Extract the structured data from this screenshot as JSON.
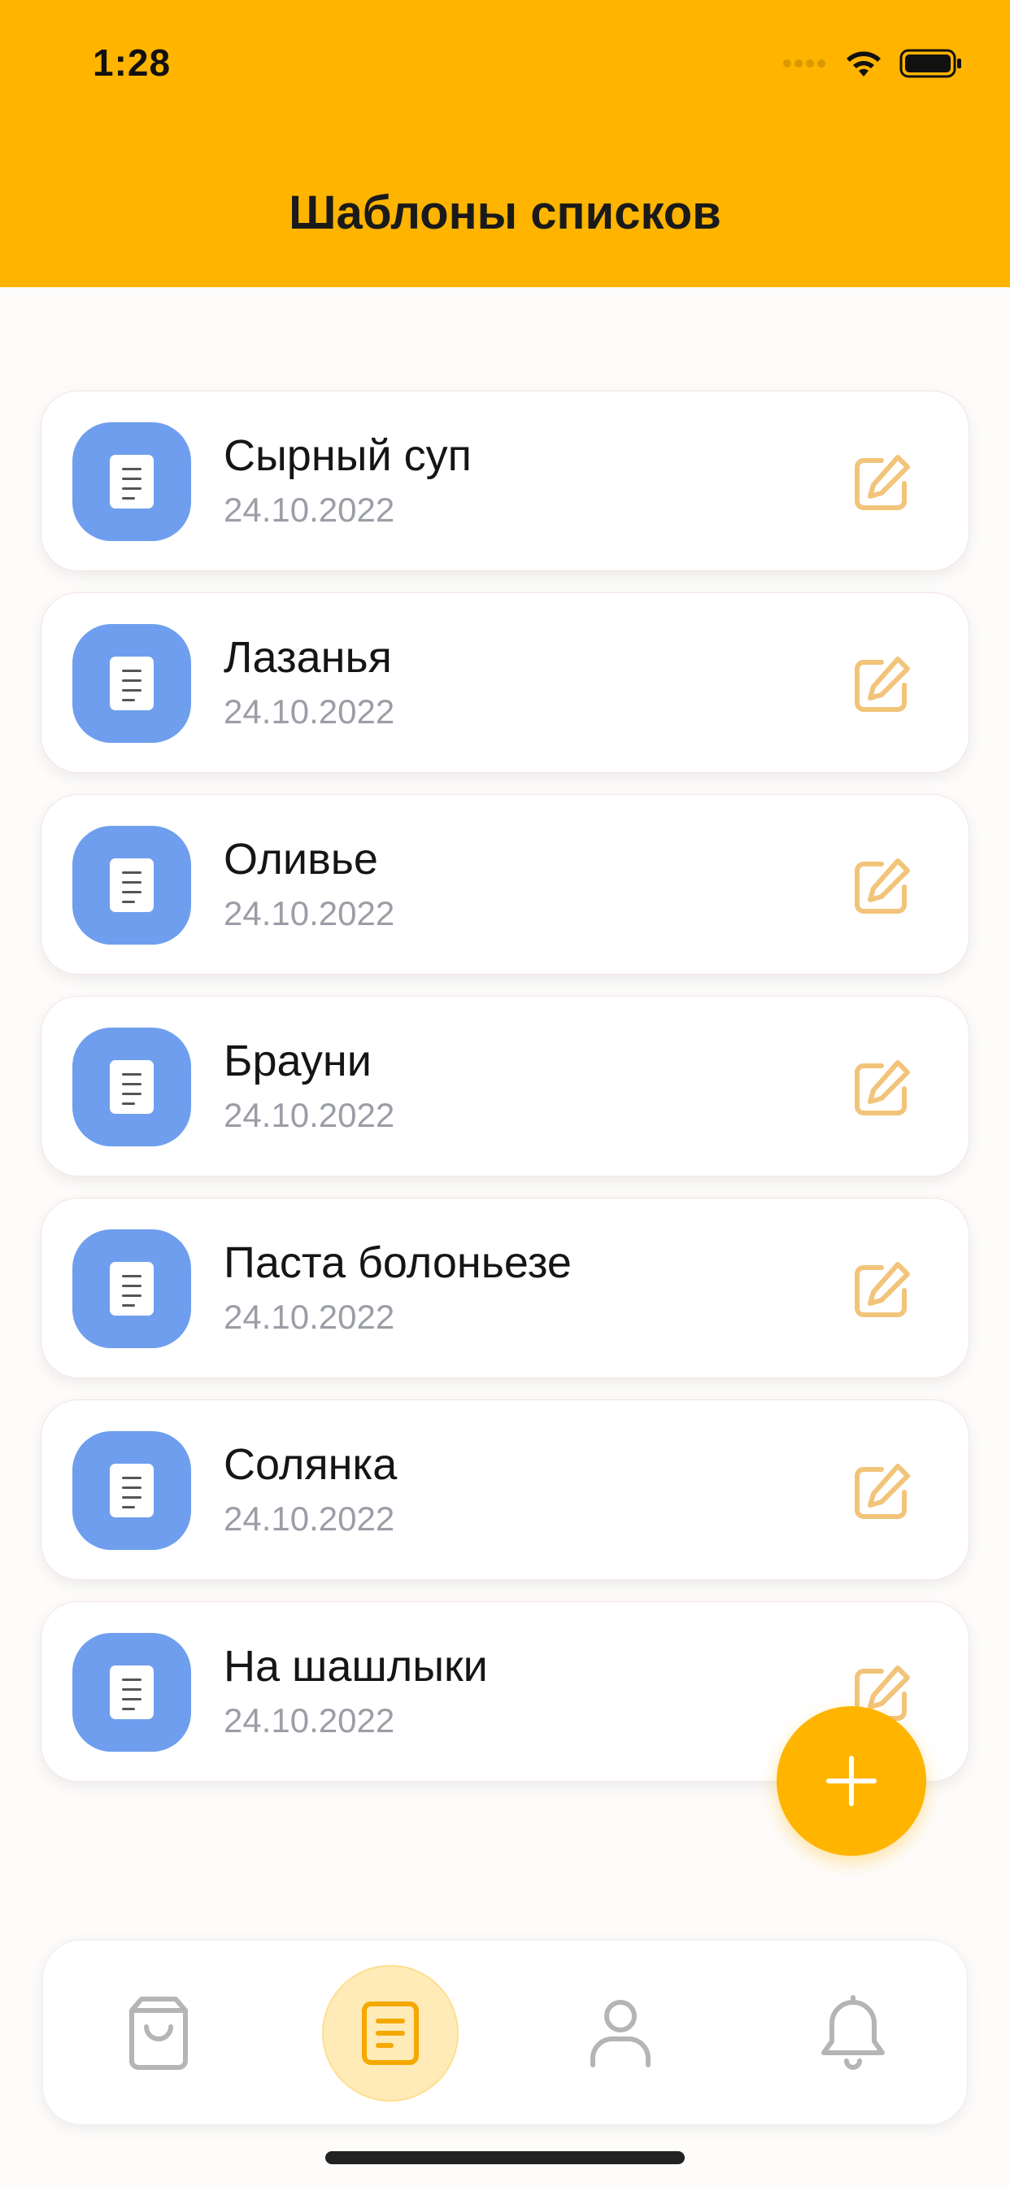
{
  "status_bar": {
    "time": "1:28"
  },
  "header": {
    "title": "Шаблоны списков"
  },
  "templates": [
    {
      "name": "Сырный суп",
      "date": "24.10.2022"
    },
    {
      "name": "Лазанья",
      "date": "24.10.2022"
    },
    {
      "name": "Оливье",
      "date": "24.10.2022"
    },
    {
      "name": "Брауни",
      "date": "24.10.2022"
    },
    {
      "name": "Паста болоньезе",
      "date": "24.10.2022"
    },
    {
      "name": "Солянка",
      "date": "24.10.2022"
    },
    {
      "name": "На шашлыки",
      "date": "24.10.2022"
    }
  ],
  "icons": {
    "item": "document-icon",
    "edit": "edit-icon",
    "fab": "plus-icon",
    "tabs": [
      "shopping-bag-icon",
      "list-icon",
      "user-icon",
      "bell-icon"
    ]
  },
  "tabbar": {
    "active_index": 1
  },
  "colors": {
    "accent": "#FFB400",
    "tile": "#6F9EEE",
    "edit_icon": "#F2C47A",
    "date_text": "#9B9EA6",
    "tab_inactive": "#B5B5B5",
    "tab_active_bg": "#FFEBB8"
  }
}
